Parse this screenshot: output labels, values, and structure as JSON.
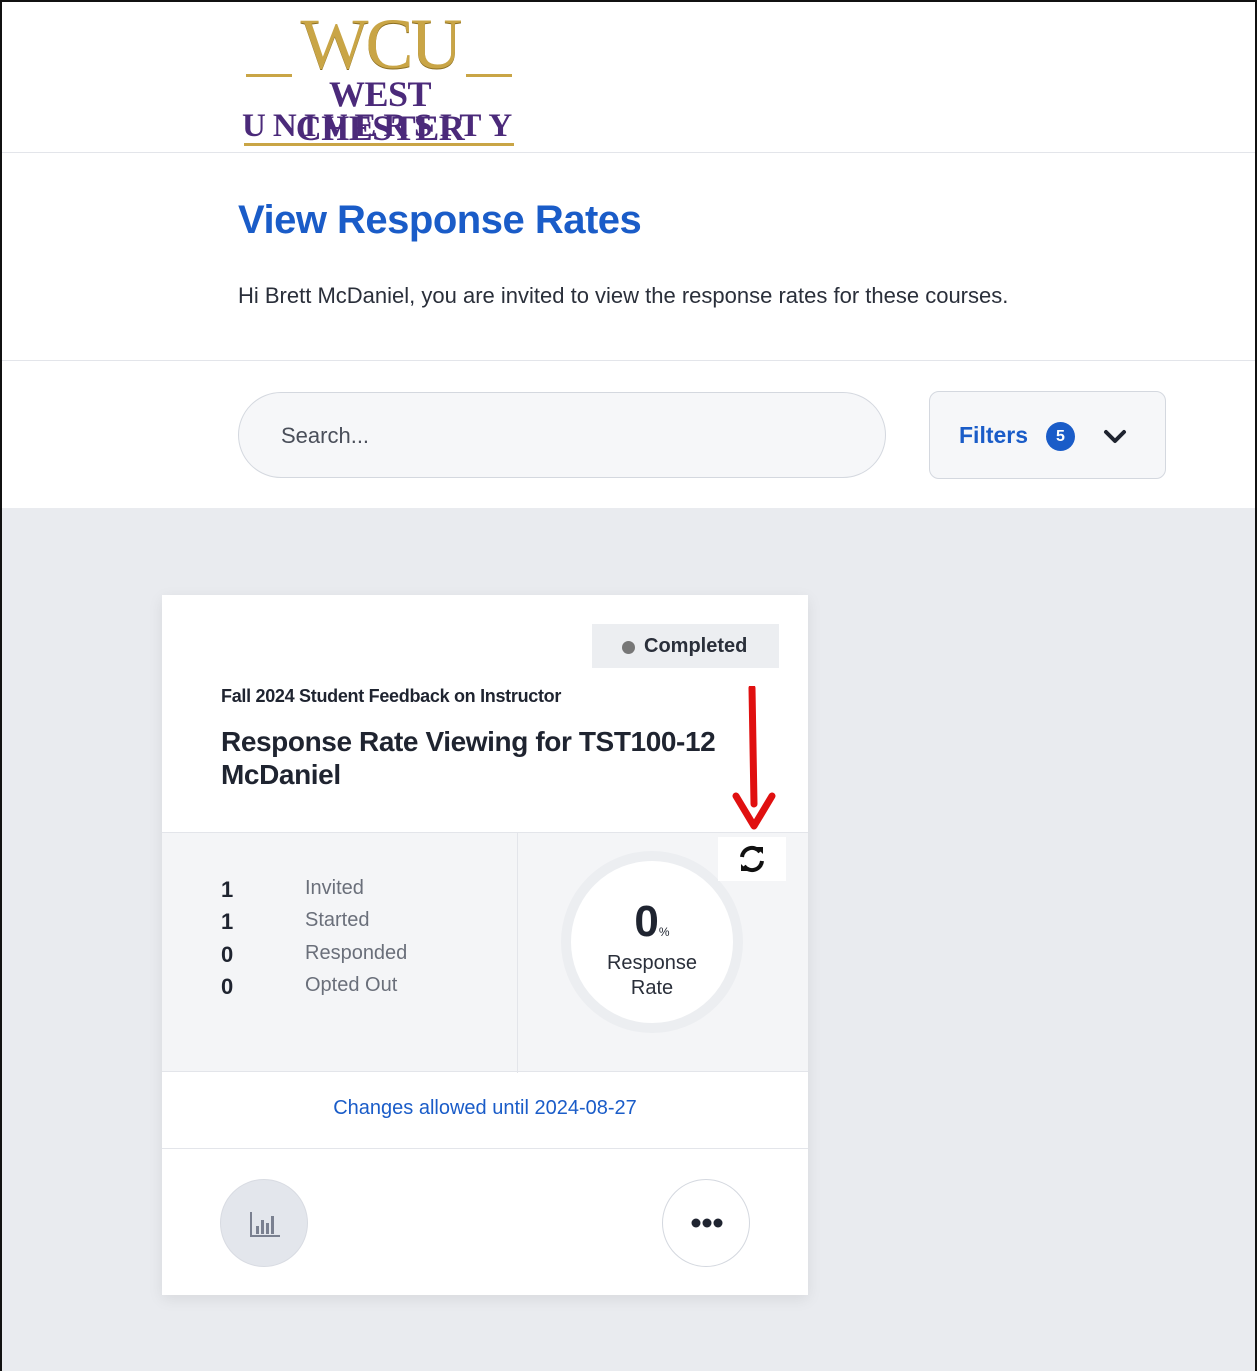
{
  "logo": {
    "mark": "WCU",
    "line1": "WEST CHESTER",
    "line2": "UNIVERSITY"
  },
  "page": {
    "title": "View Response Rates",
    "intro": "Hi Brett McDaniel, you are invited to view the response rates for these courses."
  },
  "search": {
    "placeholder": "Search..."
  },
  "filters": {
    "label": "Filters",
    "count": "5"
  },
  "card": {
    "status": "Completed",
    "survey_name": "Fall 2024 Student Feedback on Instructor",
    "course_title": "Response Rate Viewing for TST100-12 McDaniel",
    "stats": [
      {
        "value": "1",
        "label": "Invited"
      },
      {
        "value": "1",
        "label": "Started"
      },
      {
        "value": "0",
        "label": "Responded"
      },
      {
        "value": "0",
        "label": "Opted Out"
      }
    ],
    "response_rate": {
      "value": "0",
      "unit": "%",
      "label_line1": "Response",
      "label_line2": "Rate",
      "fraction": 0
    },
    "changes_text": "Changes allowed until 2024-08-27"
  },
  "icons": {
    "refresh": "refresh-icon",
    "chart": "bar-chart-icon",
    "more": "more-horizontal-icon",
    "chevron": "chevron-down-icon",
    "arrow": "red-arrow-annotation"
  },
  "colors": {
    "primary": "#1a5cc8",
    "logo_gold": "#c9a546",
    "logo_purple": "#4b2a7a",
    "annotation_red": "#e01010",
    "content_bg": "#e9ebef"
  }
}
